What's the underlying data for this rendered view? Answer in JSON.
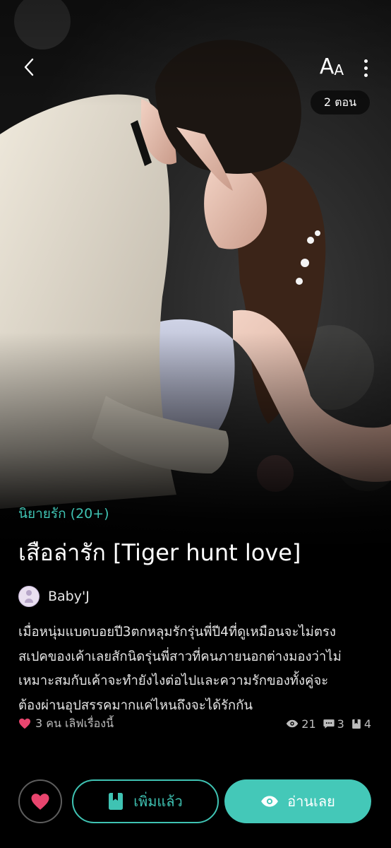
{
  "header": {
    "font_size_label_big": "A",
    "font_size_label_small": "A",
    "episode_count": "2 ตอน"
  },
  "story": {
    "genre": "นิยายรัก (20+)",
    "title": "เสือล่ารัก [Tiger hunt love]",
    "author": "Baby'J",
    "synopsis": "เมื่อหนุ่มแบดบอยปี3ตกหลุมรักรุ่นพี่ปี4ที่ดูเหมือนจะไม่ตรง\nสเปคของเค้าเลยสักนิดรุ่นพี่สาวที่คนภายนอกต่างมองว่าไม่\nเหมาะสมกับเค้าจะทำยังไงต่อไปและความรักของทั้งคู่จะ\nต้องผ่านอุปสรรคมากแค่ไหนถึงจะได้รักกัน"
  },
  "stats": {
    "likes_text": "3 คน เลิฟเรื่องนี้",
    "views": "21",
    "comments": "3",
    "bookmarks": "4"
  },
  "actions": {
    "added_label": "เพิ่มแล้ว",
    "read_label": "อ่านเลย"
  },
  "colors": {
    "accent": "#3fc3b3",
    "heart": "#e8456e",
    "background": "#000000"
  },
  "icons": [
    "back-chevron-icon",
    "font-size-icon",
    "more-vertical-icon",
    "heart-icon",
    "eye-icon",
    "comment-icon",
    "bookmark-icon",
    "book-icon"
  ]
}
